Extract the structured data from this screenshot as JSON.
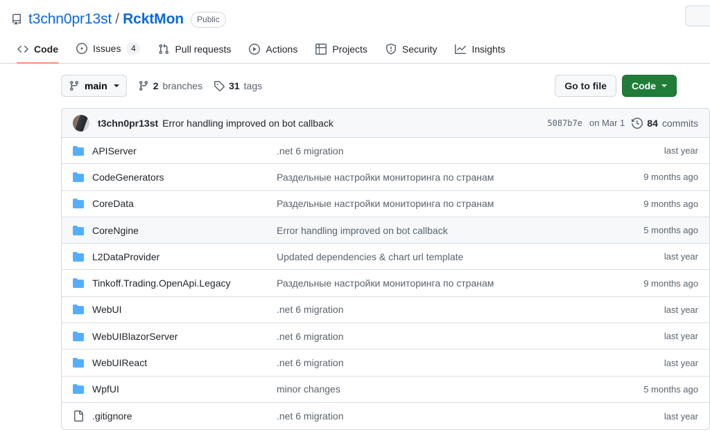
{
  "header": {
    "repo_icon": "repo-icon",
    "owner": "t3chn0pr13st",
    "separator": "/",
    "name": "RcktMon",
    "visibility": "Public"
  },
  "nav": {
    "tabs": [
      {
        "label": "Code",
        "icon": "code-icon",
        "active": true,
        "count": null
      },
      {
        "label": "Issues",
        "icon": "issue-opened-icon",
        "active": false,
        "count": "4"
      },
      {
        "label": "Pull requests",
        "icon": "git-pull-request-icon",
        "active": false,
        "count": null
      },
      {
        "label": "Actions",
        "icon": "play-icon",
        "active": false,
        "count": null
      },
      {
        "label": "Projects",
        "icon": "table-icon",
        "active": false,
        "count": null
      },
      {
        "label": "Security",
        "icon": "shield-icon",
        "active": false,
        "count": null
      },
      {
        "label": "Insights",
        "icon": "graph-icon",
        "active": false,
        "count": null
      }
    ]
  },
  "toolbar": {
    "branch": "main",
    "branch_icon": "git-branch-icon",
    "branches_count": "2",
    "branches_label": "branches",
    "tags_count": "31",
    "tags_label": "tags",
    "tag_icon": "tag-icon",
    "go_to_file": "Go to file",
    "code_button": "Code"
  },
  "commit_bar": {
    "author": "t3chn0pr13st",
    "message": "Error handling improved on bot callback",
    "sha": "5087b7e",
    "date": "on Mar 1",
    "history_icon": "history-icon",
    "commits_count": "84",
    "commits_label": "commits"
  },
  "files": {
    "rows": [
      {
        "type": "folder",
        "name": "APIServer",
        "message": ".net 6 migration",
        "time": "last year",
        "hover": false
      },
      {
        "type": "folder",
        "name": "CodeGenerators",
        "message": "Раздельные настройки мониторинга по странам",
        "time": "9 months ago",
        "hover": false
      },
      {
        "type": "folder",
        "name": "CoreData",
        "message": "Раздельные настройки мониторинга по странам",
        "time": "9 months ago",
        "hover": false
      },
      {
        "type": "folder",
        "name": "CoreNgine",
        "message": "Error handling improved on bot callback",
        "time": "5 months ago",
        "hover": true
      },
      {
        "type": "folder",
        "name": "L2DataProvider",
        "message": "Updated dependencies & chart url template",
        "time": "last year",
        "hover": false
      },
      {
        "type": "folder",
        "name": "Tinkoff.Trading.OpenApi.Legacy",
        "message": "Раздельные настройки мониторинга по странам",
        "time": "9 months ago",
        "hover": false
      },
      {
        "type": "folder",
        "name": "WebUI",
        "message": ".net 6 migration",
        "time": "last year",
        "hover": false
      },
      {
        "type": "folder",
        "name": "WebUIBlazorServer",
        "message": ".net 6 migration",
        "time": "last year",
        "hover": false
      },
      {
        "type": "folder",
        "name": "WebUIReact",
        "message": ".net 6 migration",
        "time": "last year",
        "hover": false
      },
      {
        "type": "folder",
        "name": "WpfUI",
        "message": "minor changes",
        "time": "5 months ago",
        "hover": false
      },
      {
        "type": "file",
        "name": ".gitignore",
        "message": ".net 6 migration",
        "time": "last year",
        "hover": false
      }
    ]
  },
  "colors": {
    "link": "#0969da",
    "accent_underline": "#fd8c73",
    "primary_button": "#1f7d38",
    "folder": "#54aeff",
    "muted_text": "#59636e"
  }
}
